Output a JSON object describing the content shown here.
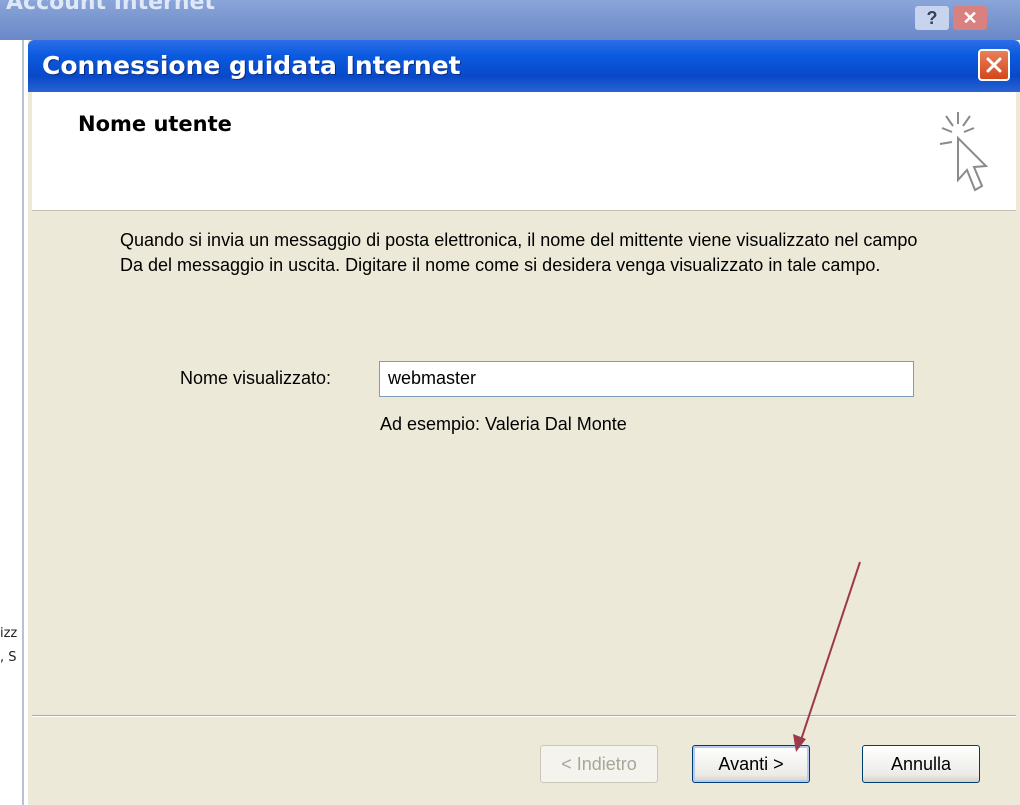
{
  "background_window": {
    "title": "Account Internet",
    "side_text_1": "izz",
    "side_text_2": ", S"
  },
  "dialog": {
    "title": "Connessione guidata Internet",
    "header_title": "Nome utente",
    "description": "Quando si invia un messaggio di posta elettronica, il nome del mittente viene visualizzato nel campo Da del messaggio in uscita. Digitare il nome come si desidera venga visualizzato in tale campo.",
    "field_label": "Nome visualizzato:",
    "field_value": "webmaster",
    "hint": "Ad esempio: Valeria Dal Monte"
  },
  "buttons": {
    "back": "< Indietro",
    "next": "Avanti >",
    "cancel": "Annulla"
  },
  "colors": {
    "titlebar": "#0a5adf",
    "dialog_bg": "#ece9d8",
    "annotation_arrow": "#9b3a4a"
  },
  "icons": {
    "wizard": "wizard-cursor-icon",
    "close": "close-icon"
  }
}
